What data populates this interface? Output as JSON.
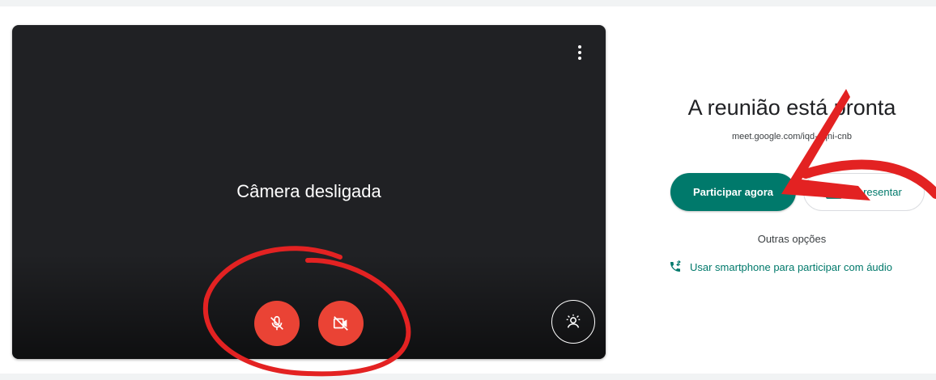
{
  "preview": {
    "status_text": "Câmera desligada",
    "more_options_icon": "more-vert-icon",
    "mic_icon": "mic-off-icon",
    "camera_icon": "videocam-off-icon",
    "effects_icon": "visual-effects-icon"
  },
  "join_panel": {
    "title": "A reunião está pronta",
    "meeting_link": "meet.google.com/iqd-uqni-cnb",
    "join_button_label": "Participar agora",
    "present_button_label": "Apresentar",
    "present_icon": "present-screen-icon",
    "other_options_label": "Outras opções",
    "phone_option_label": "Usar smartphone para participar com áudio",
    "phone_icon": "phone-forward-icon"
  },
  "colors": {
    "accent": "#00796b",
    "danger": "#ea4335",
    "preview_bg": "#202124",
    "annotation_red": "#e32222"
  }
}
